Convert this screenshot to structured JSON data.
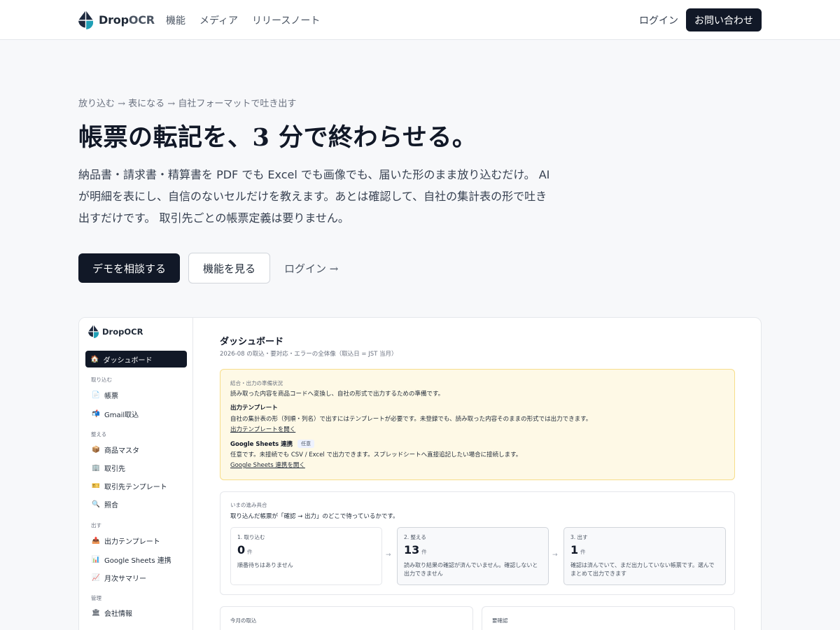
{
  "nav": {
    "brand_prefix": "Drop",
    "brand_suffix": "OCR",
    "links": [
      "機能",
      "メディア",
      "リリースノート"
    ],
    "login": "ログイン",
    "contact": "お問い合わせ"
  },
  "hero": {
    "eyebrow": "放り込む → 表になる → 自社フォーマットで吐き出す",
    "title": "帳票の転記を、3 分で終わらせる。",
    "description": "納品書・請求書・精算書を PDF でも Excel でも画像でも、届いた形のまま放り込むだけ。 AI が明細を表にし、自信のないセルだけを教えます。あとは確認して、自社の集計表の形で吐き出すだけです。 取引先ごとの帳票定義は要りません。",
    "cta_primary": "デモを相談する",
    "cta_secondary": "機能を見る",
    "cta_login": "ログイン →"
  },
  "app": {
    "brand": "DropOCR",
    "sidebar": {
      "active": {
        "icon": "home-icon",
        "glyph": "🏠",
        "label": "ダッシュボード"
      },
      "sections": [
        {
          "title": "取り込む",
          "items": [
            {
              "icon": "document-icon",
              "glyph": "📄",
              "label": "帳票"
            },
            {
              "icon": "mail-icon",
              "glyph": "📬",
              "label": "Gmail取込"
            }
          ]
        },
        {
          "title": "整える",
          "items": [
            {
              "icon": "package-icon",
              "glyph": "📦",
              "label": "商品マスタ"
            },
            {
              "icon": "building-icon",
              "glyph": "🏢",
              "label": "取引先"
            },
            {
              "icon": "ticket-icon",
              "glyph": "🎫",
              "label": "取引先テンプレート"
            },
            {
              "icon": "search-icon",
              "glyph": "🔍",
              "label": "照合"
            }
          ]
        },
        {
          "title": "出す",
          "items": [
            {
              "icon": "outbox-icon",
              "glyph": "📤",
              "label": "出力テンプレート"
            },
            {
              "icon": "bar-chart-icon",
              "glyph": "📊",
              "label": "Google Sheets 連携"
            },
            {
              "icon": "trend-chart-icon",
              "glyph": "📈",
              "label": "月次サマリー"
            }
          ]
        },
        {
          "title": "管理",
          "items": [
            {
              "icon": "bank-icon",
              "glyph": "🏛",
              "label": "会社情報"
            }
          ]
        }
      ]
    },
    "main": {
      "title": "ダッシュボード",
      "subtitle": "2026-08 の取込・要対応・エラーの全体像（取込日 = JST 当月）",
      "notice": {
        "label": "結合・出力の準備状況",
        "intro": "読み取った内容を商品コードへ変換し、自社の形式で出力するための準備です。",
        "output_heading": "出力テンプレート",
        "output_text": "自社の集計表の形（列順・列名）で出すにはテンプレートが必要です。未登録でも、読み取った内容そのままの形式では出力できます。",
        "output_link": "出力テンプレートを開く",
        "sheets_heading": "Google Sheets 連携",
        "sheets_badge": "任意",
        "sheets_text": "任意です。未接続でも CSV / Excel で出力できます。スプレッドシートへ直接追記したい場合に接続します。",
        "sheets_link": "Google Sheets 連携を開く"
      },
      "progress": {
        "label": "いまの進み具合",
        "description": "取り込んだ帳票が「確認 → 出力」のどこで待っているかです。",
        "steps": [
          {
            "title": "1. 取り込む",
            "count": "0",
            "unit": "件",
            "note": "順番待ちはありません"
          },
          {
            "title": "2. 整える",
            "count": "13",
            "unit": "件",
            "note": "読み取り結果の確認が済んでいません。確認しないと出力できません"
          },
          {
            "title": "3. 出す",
            "count": "1",
            "unit": "件",
            "note": "確認は済んでいて、まだ出力していない帳票です。選んでまとめて出力できます"
          }
        ],
        "arrow": "→"
      },
      "bottom_cards": [
        "今月の取込",
        "要確認"
      ]
    }
  }
}
